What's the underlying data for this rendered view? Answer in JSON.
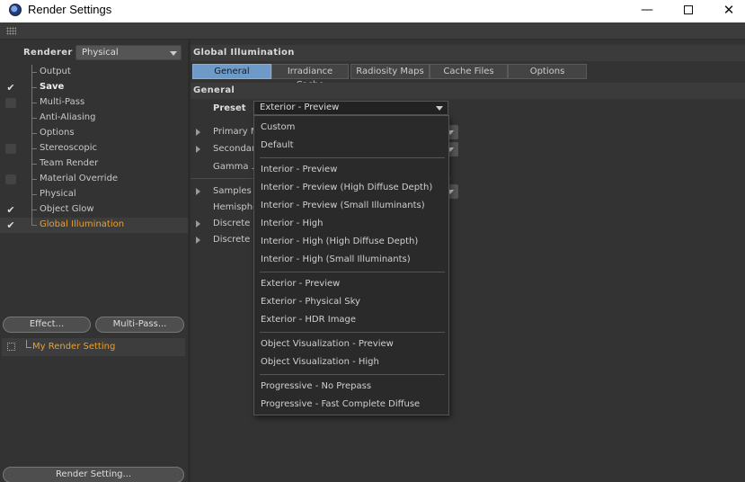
{
  "window": {
    "title": "Render Settings",
    "minimize": "—",
    "close": "✕"
  },
  "renderer": {
    "label": "Renderer",
    "value": "Physical"
  },
  "tree": [
    {
      "label": "Output",
      "checkbox": "none",
      "checked": false,
      "style": "normal"
    },
    {
      "label": "Save",
      "checkbox": "box",
      "checked": true,
      "style": "bold"
    },
    {
      "label": "Multi-Pass",
      "checkbox": "box",
      "checked": false,
      "style": "normal"
    },
    {
      "label": "Anti-Aliasing",
      "checkbox": "none",
      "checked": false,
      "style": "normal"
    },
    {
      "label": "Options",
      "checkbox": "none",
      "checked": false,
      "style": "normal"
    },
    {
      "label": "Stereoscopic",
      "checkbox": "box",
      "checked": false,
      "style": "normal"
    },
    {
      "label": "Team Render",
      "checkbox": "none",
      "checked": false,
      "style": "normal"
    },
    {
      "label": "Material Override",
      "checkbox": "box",
      "checked": false,
      "style": "normal"
    },
    {
      "label": "Physical",
      "checkbox": "none",
      "checked": false,
      "style": "normal"
    },
    {
      "label": "Object Glow",
      "checkbox": "box",
      "checked": true,
      "style": "normal"
    },
    {
      "label": "Global Illumination",
      "checkbox": "box",
      "checked": true,
      "style": "orange"
    }
  ],
  "buttons": {
    "effect": "Effect...",
    "multipass": "Multi-Pass...",
    "render_setting": "Render Setting..."
  },
  "setting_list": {
    "item": "My Render Setting"
  },
  "panel": {
    "section_title": "Global Illumination",
    "subsection_title": "General",
    "tabs": [
      "General",
      "Irradiance Cache",
      "Radiosity Maps",
      "Cache Files",
      "Options"
    ],
    "active_tab": 0,
    "preset_label": "Preset",
    "preset_value": "Exterior - Preview",
    "rows": [
      {
        "label": "Primary M",
        "expandable": true,
        "select": true
      },
      {
        "label": "Secondar",
        "expandable": true,
        "select": true
      },
      {
        "label": "Gamma . .",
        "expandable": false,
        "select": false
      },
      {
        "label": "Samples .",
        "expandable": true,
        "select": true
      },
      {
        "label": "Hemispher",
        "expandable": false,
        "select": false
      },
      {
        "label": "Discrete",
        "expandable": true,
        "select": false
      },
      {
        "label": "Discrete",
        "expandable": true,
        "select": false
      }
    ]
  },
  "dropdown": {
    "groups": [
      [
        "Custom",
        "Default"
      ],
      [
        "Interior - Preview",
        "Interior - Preview (High Diffuse Depth)",
        "Interior - Preview (Small Illuminants)",
        "Interior - High",
        "Interior - High (High Diffuse Depth)",
        "Interior - High (Small Illuminants)"
      ],
      [
        "Exterior - Preview",
        "Exterior - Physical Sky",
        "Exterior - HDR Image"
      ],
      [
        "Object Visualization - Preview",
        "Object Visualization - High"
      ],
      [
        "Progressive - No Prepass",
        "Progressive - Fast Complete Diffuse"
      ]
    ]
  },
  "colors": {
    "accent_tab": "#6e9ac8",
    "highlight_text": "#f0a020",
    "panel_bg": "#333333"
  }
}
